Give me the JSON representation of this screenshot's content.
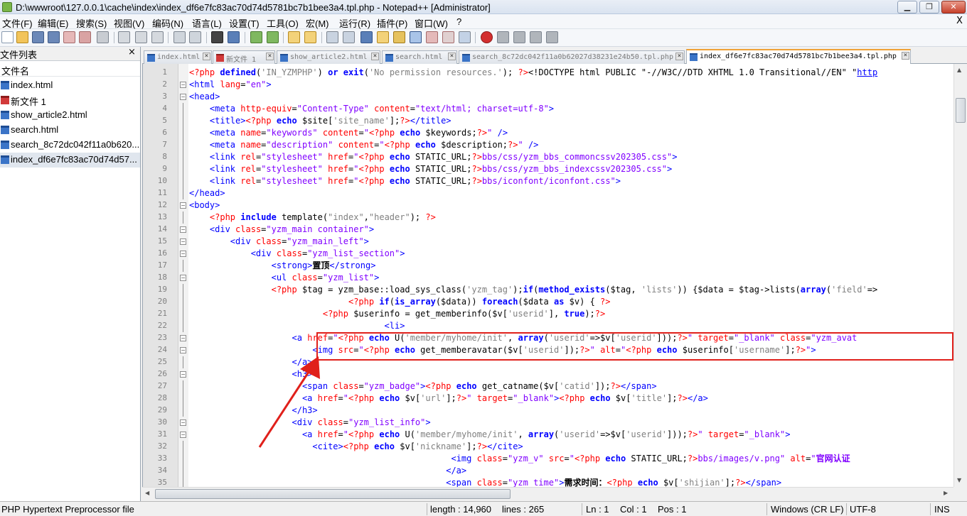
{
  "window": {
    "title": "D:\\wwwroot\\127.0.0.1\\cache\\index\\index_df6e7fc83ac70d74d5781bc7b1bee3a4.tpl.php - Notepad++ [Administrator]",
    "minimize": "▁",
    "maximize": "❐",
    "close": "✕"
  },
  "menu": {
    "items": [
      "文件(F)",
      "编辑(E)",
      "搜索(S)",
      "视图(V)",
      "编码(N)",
      "语言(L)",
      "设置(T)",
      "工具(O)",
      "宏(M)",
      "运行(R)",
      "插件(P)",
      "窗口(W)",
      "?"
    ],
    "close": "X"
  },
  "sidebar": {
    "title": "文件列表",
    "close": "×",
    "header": "文件名",
    "files": [
      {
        "name": "index.html",
        "color": "blue"
      },
      {
        "name": "新文件 1",
        "color": "red"
      },
      {
        "name": "show_article2.html",
        "color": "blue"
      },
      {
        "name": "search.html",
        "color": "blue"
      },
      {
        "name": "search_8c72dc042f11a0b620...",
        "color": "blue"
      },
      {
        "name": "index_df6e7fc83ac70d74d57...",
        "color": "blue"
      }
    ]
  },
  "tabs": [
    {
      "label": "index.html",
      "close": "×"
    },
    {
      "label": "新文件 1",
      "close": "×"
    },
    {
      "label": "show_article2.html",
      "close": "×"
    },
    {
      "label": "search.html",
      "close": "×"
    },
    {
      "label": "search_8c72dc042f11a0b62027d38231e24b50.tpl.php",
      "close": "×"
    },
    {
      "label": "index_df6e7fc83ac70d74d5781bc7b1bee3a4.tpl.php",
      "close": "×"
    }
  ],
  "editor": {
    "line_numbers": [
      "1",
      "2",
      "3",
      "4",
      "5",
      "6",
      "7",
      "8",
      "9",
      "10",
      "11",
      "12",
      "13",
      "14",
      "15",
      "16",
      "17",
      "18",
      "19",
      "20",
      "21",
      "22",
      "23",
      "24",
      "25",
      "26",
      "27",
      "28",
      "29",
      "30",
      "31",
      "32",
      "33",
      "34",
      "35"
    ]
  },
  "status": {
    "file_type": "PHP Hypertext Preprocessor file",
    "length": "length : 14,960",
    "lines": "lines : 265",
    "ln": "Ln : 1",
    "col": "Col : 1",
    "pos": "Pos : 1",
    "eol": "Windows (CR LF)",
    "encoding": "UTF-8",
    "mode": "INS"
  },
  "annotation": {
    "color": "#e0201b"
  }
}
